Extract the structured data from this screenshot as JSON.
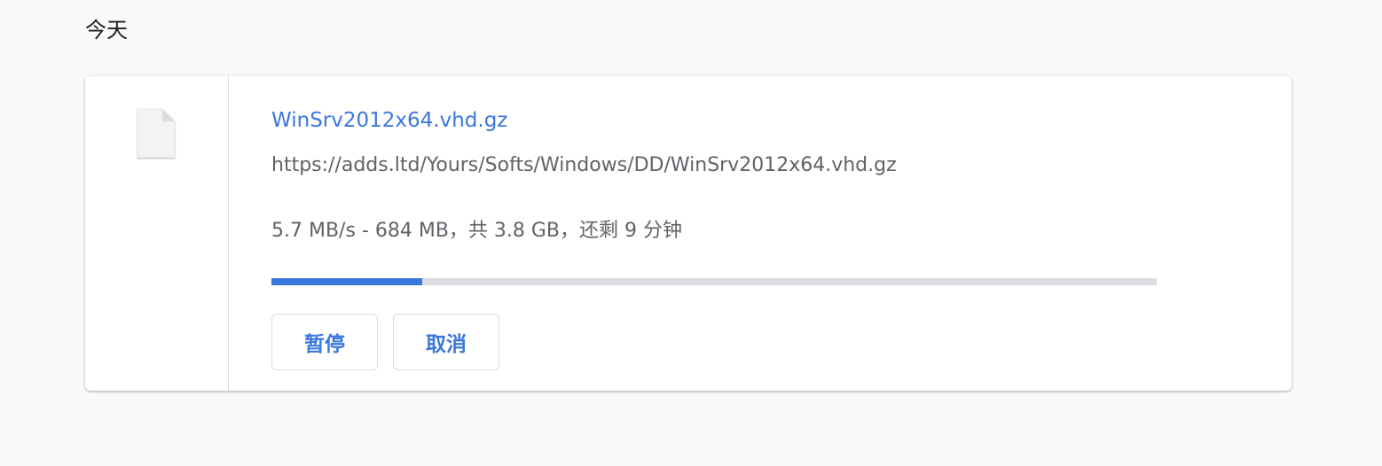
{
  "section": {
    "date_label": "今天"
  },
  "download": {
    "file_name": "WinSrv2012x64.vhd.gz",
    "url": "https://adds.ltd/Yours/Softs/Windows/DD/WinSrv2012x64.vhd.gz",
    "status_text": "5.7 MB/s - 684 MB，共 3.8 GB，还剩 9 分钟",
    "progress_fraction": 0.17,
    "icon": "file-icon",
    "buttons": {
      "pause_label": "暂停",
      "cancel_label": "取消"
    }
  },
  "colors": {
    "accent": "#3b78dc",
    "secondary_text": "#5f6368",
    "track": "#dadce0",
    "background": "#f8f9fa"
  }
}
